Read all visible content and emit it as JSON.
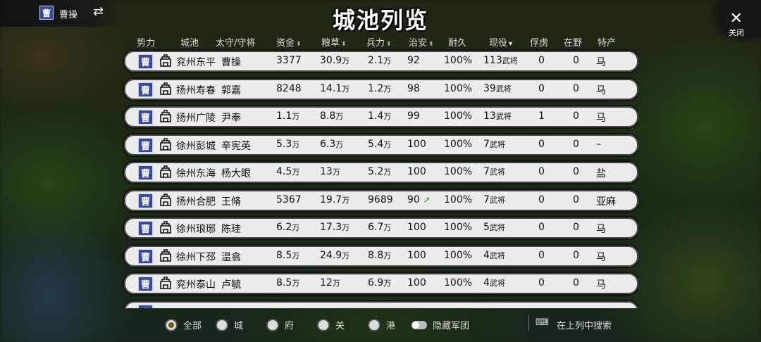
{
  "faction": {
    "name": "曹操",
    "seal": "曹",
    "switch_icon": "⇄"
  },
  "title": "城池列览",
  "close": {
    "label": "关闭",
    "icon": "✕"
  },
  "columns": [
    "势力",
    "城池",
    "太守/守将",
    "资金",
    "粮草",
    "兵力",
    "治安",
    "耐久",
    "现役",
    "俘虏",
    "在野",
    "特产"
  ],
  "sort_marks": {
    "inactive": "⬍",
    "active": "▾"
  },
  "rows": [
    {
      "seal": "曹",
      "city": "兖州东平",
      "governor": "曹操",
      "gold": "3377",
      "gold_unit": "",
      "food": "30.9",
      "food_unit": "万",
      "troops": "2.1",
      "troops_unit": "万",
      "order": "92",
      "order_up": false,
      "durability": "100%",
      "generals": "113",
      "generals_unit": "武将",
      "captives": "0",
      "wild": "0",
      "specialty": "马"
    },
    {
      "seal": "曹",
      "city": "扬州寿春",
      "governor": "郭嘉",
      "gold": "8248",
      "gold_unit": "",
      "food": "14.1",
      "food_unit": "万",
      "troops": "1.2",
      "troops_unit": "万",
      "order": "98",
      "order_up": false,
      "durability": "100%",
      "generals": "39",
      "generals_unit": "武将",
      "captives": "0",
      "wild": "0",
      "specialty": "马"
    },
    {
      "seal": "曹",
      "city": "扬州广陵",
      "governor": "尹奉",
      "gold": "1.1",
      "gold_unit": "万",
      "food": "8.8",
      "food_unit": "万",
      "troops": "1.4",
      "troops_unit": "万",
      "order": "99",
      "order_up": false,
      "durability": "100%",
      "generals": "13",
      "generals_unit": "武将",
      "captives": "1",
      "wild": "0",
      "specialty": "马"
    },
    {
      "seal": "曹",
      "city": "徐州彭城",
      "governor": "辛宪英",
      "gold": "5.3",
      "gold_unit": "万",
      "food": "6.3",
      "food_unit": "万",
      "troops": "5.4",
      "troops_unit": "万",
      "order": "100",
      "order_up": false,
      "durability": "100%",
      "generals": "7",
      "generals_unit": "武将",
      "captives": "0",
      "wild": "0",
      "specialty": "–"
    },
    {
      "seal": "曹",
      "city": "徐州东海",
      "governor": "杨大眼",
      "gold": "4.5",
      "gold_unit": "万",
      "food": "13",
      "food_unit": "万",
      "troops": "5.2",
      "troops_unit": "万",
      "order": "100",
      "order_up": false,
      "durability": "100%",
      "generals": "7",
      "generals_unit": "武将",
      "captives": "0",
      "wild": "0",
      "specialty": "盐"
    },
    {
      "seal": "曹",
      "city": "扬州合肥",
      "governor": "王脩",
      "gold": "5367",
      "gold_unit": "",
      "food": "19.7",
      "food_unit": "万",
      "troops": "9689",
      "troops_unit": "",
      "order": "90",
      "order_up": true,
      "durability": "100%",
      "generals": "7",
      "generals_unit": "武将",
      "captives": "0",
      "wild": "0",
      "specialty": "亚麻"
    },
    {
      "seal": "曹",
      "city": "徐州琅琊",
      "governor": "陈珪",
      "gold": "6.2",
      "gold_unit": "万",
      "food": "17.3",
      "food_unit": "万",
      "troops": "6.7",
      "troops_unit": "万",
      "order": "100",
      "order_up": false,
      "durability": "100%",
      "generals": "5",
      "generals_unit": "武将",
      "captives": "0",
      "wild": "0",
      "specialty": "马"
    },
    {
      "seal": "曹",
      "city": "徐州下邳",
      "governor": "温翕",
      "gold": "8.5",
      "gold_unit": "万",
      "food": "24.9",
      "food_unit": "万",
      "troops": "8.8",
      "troops_unit": "万",
      "order": "100",
      "order_up": false,
      "durability": "100%",
      "generals": "4",
      "generals_unit": "武将",
      "captives": "0",
      "wild": "0",
      "specialty": "马"
    },
    {
      "seal": "曹",
      "city": "兖州泰山",
      "governor": "卢毓",
      "gold": "8.5",
      "gold_unit": "万",
      "food": "12",
      "food_unit": "万",
      "troops": "6.9",
      "troops_unit": "万",
      "order": "100",
      "order_up": false,
      "durability": "100%",
      "generals": "4",
      "generals_unit": "武将",
      "captives": "0",
      "wild": "0",
      "specialty": "马"
    }
  ],
  "partial_row_seal": "曹",
  "filters": [
    {
      "label": "全部",
      "checked": true
    },
    {
      "label": "城",
      "checked": false
    },
    {
      "label": "府",
      "checked": false
    },
    {
      "label": "关",
      "checked": false
    },
    {
      "label": "港",
      "checked": false
    }
  ],
  "hide_army_label": "隐藏军团",
  "search": {
    "icon": "⌨",
    "label": "在上列中搜索"
  },
  "colors": {
    "seal_bg": "#3a4a9a",
    "row_bg": "#ececec",
    "up_arrow": "#3aa53a"
  }
}
